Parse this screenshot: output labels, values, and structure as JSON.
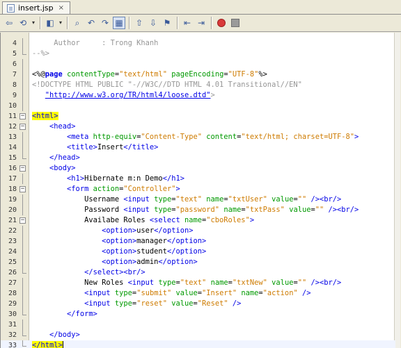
{
  "tab": {
    "label": "insert.jsp",
    "close": "×"
  },
  "toolbar": {
    "buttons": [
      {
        "name": "back-source-icon",
        "glyph": "⇦"
      },
      {
        "name": "history-icon",
        "glyph": "⟲"
      },
      {
        "name": "prev-edit-icon",
        "glyph": "◧"
      },
      {
        "name": "find-icon",
        "glyph": "⌕"
      },
      {
        "name": "find-prev-icon",
        "glyph": "↶"
      },
      {
        "name": "find-next-icon",
        "glyph": "↷"
      },
      {
        "name": "toggle-highlight-icon",
        "glyph": "▦"
      },
      {
        "name": "prev-bookmark-icon",
        "glyph": "⇧"
      },
      {
        "name": "next-bookmark-icon",
        "glyph": "⇩"
      },
      {
        "name": "toggle-bookmark-icon",
        "glyph": "⚑"
      },
      {
        "name": "shift-left-icon",
        "glyph": "⇤"
      },
      {
        "name": "shift-right-icon",
        "glyph": "⇥"
      }
    ]
  },
  "editor": {
    "lines": [
      {
        "n": "4",
        "fold": "",
        "segs": [
          {
            "c": "com",
            "t": "     Author     : Trong Khanh"
          }
        ]
      },
      {
        "n": "5",
        "fold": "end",
        "segs": [
          {
            "c": "com",
            "t": "--%>"
          }
        ]
      },
      {
        "n": "6",
        "fold": "",
        "segs": []
      },
      {
        "n": "7",
        "fold": "",
        "segs": [
          {
            "c": "dir",
            "t": "<%@"
          },
          {
            "c": "kw",
            "t": "page"
          },
          {
            "c": "txt",
            "t": " "
          },
          {
            "c": "attr",
            "t": "contentType"
          },
          {
            "c": "txt",
            "t": "="
          },
          {
            "c": "val",
            "t": "\"text/html\""
          },
          {
            "c": "txt",
            "t": " "
          },
          {
            "c": "attr",
            "t": "pageEncoding"
          },
          {
            "c": "txt",
            "t": "="
          },
          {
            "c": "val",
            "t": "\"UTF-8\""
          },
          {
            "c": "dir",
            "t": "%>"
          }
        ]
      },
      {
        "n": "8",
        "fold": "",
        "segs": [
          {
            "c": "com",
            "t": "<!DOCTYPE HTML PUBLIC \"-//W3C//DTD HTML 4.01 Transitional//EN\""
          }
        ]
      },
      {
        "n": "9",
        "fold": "",
        "segs": [
          {
            "c": "txt",
            "t": "   "
          },
          {
            "c": "link",
            "t": "\"http://www.w3.org/TR/html4/loose.dtd\""
          },
          {
            "c": "com",
            "t": ">"
          }
        ]
      },
      {
        "n": "10",
        "fold": "",
        "segs": []
      },
      {
        "n": "11",
        "fold": "open",
        "segs": [
          {
            "c": "hl",
            "t": "<html>"
          }
        ]
      },
      {
        "n": "12",
        "fold": "open",
        "segs": [
          {
            "c": "txt",
            "t": "    "
          },
          {
            "c": "tag",
            "t": "<head>"
          }
        ]
      },
      {
        "n": "13",
        "fold": "",
        "segs": [
          {
            "c": "txt",
            "t": "        "
          },
          {
            "c": "tag",
            "t": "<meta"
          },
          {
            "c": "txt",
            "t": " "
          },
          {
            "c": "attr",
            "t": "http-equiv"
          },
          {
            "c": "txt",
            "t": "="
          },
          {
            "c": "val",
            "t": "\"Content-Type\""
          },
          {
            "c": "txt",
            "t": " "
          },
          {
            "c": "attr",
            "t": "content"
          },
          {
            "c": "txt",
            "t": "="
          },
          {
            "c": "val",
            "t": "\"text/html; charset=UTF-8\""
          },
          {
            "c": "tag",
            "t": ">"
          }
        ]
      },
      {
        "n": "14",
        "fold": "",
        "segs": [
          {
            "c": "txt",
            "t": "        "
          },
          {
            "c": "tag",
            "t": "<title>"
          },
          {
            "c": "txt",
            "t": "Insert"
          },
          {
            "c": "tag",
            "t": "</title>"
          }
        ]
      },
      {
        "n": "15",
        "fold": "end",
        "segs": [
          {
            "c": "txt",
            "t": "    "
          },
          {
            "c": "tag",
            "t": "</head>"
          }
        ]
      },
      {
        "n": "16",
        "fold": "open",
        "segs": [
          {
            "c": "txt",
            "t": "    "
          },
          {
            "c": "tag",
            "t": "<body>"
          }
        ]
      },
      {
        "n": "17",
        "fold": "",
        "segs": [
          {
            "c": "txt",
            "t": "        "
          },
          {
            "c": "tag",
            "t": "<h1>"
          },
          {
            "c": "txt",
            "t": "Hibernate m:n Demo"
          },
          {
            "c": "tag",
            "t": "</h1>"
          }
        ]
      },
      {
        "n": "18",
        "fold": "open",
        "segs": [
          {
            "c": "txt",
            "t": "        "
          },
          {
            "c": "tag",
            "t": "<form"
          },
          {
            "c": "txt",
            "t": " "
          },
          {
            "c": "attr",
            "t": "action"
          },
          {
            "c": "txt",
            "t": "="
          },
          {
            "c": "val",
            "t": "\"Controller\""
          },
          {
            "c": "tag",
            "t": ">"
          }
        ]
      },
      {
        "n": "19",
        "fold": "",
        "segs": [
          {
            "c": "txt",
            "t": "            Username "
          },
          {
            "c": "tag",
            "t": "<input"
          },
          {
            "c": "txt",
            "t": " "
          },
          {
            "c": "attr",
            "t": "type"
          },
          {
            "c": "txt",
            "t": "="
          },
          {
            "c": "val",
            "t": "\"text\""
          },
          {
            "c": "txt",
            "t": " "
          },
          {
            "c": "attr",
            "t": "name"
          },
          {
            "c": "txt",
            "t": "="
          },
          {
            "c": "val",
            "t": "\"txtUser\""
          },
          {
            "c": "txt",
            "t": " "
          },
          {
            "c": "attr",
            "t": "value"
          },
          {
            "c": "txt",
            "t": "="
          },
          {
            "c": "val",
            "t": "\"\""
          },
          {
            "c": "txt",
            "t": " "
          },
          {
            "c": "tag",
            "t": "/><br/>"
          }
        ]
      },
      {
        "n": "20",
        "fold": "",
        "segs": [
          {
            "c": "txt",
            "t": "            Password "
          },
          {
            "c": "tag",
            "t": "<input"
          },
          {
            "c": "txt",
            "t": " "
          },
          {
            "c": "attr",
            "t": "type"
          },
          {
            "c": "txt",
            "t": "="
          },
          {
            "c": "val",
            "t": "\"password\""
          },
          {
            "c": "txt",
            "t": " "
          },
          {
            "c": "attr",
            "t": "name"
          },
          {
            "c": "txt",
            "t": "="
          },
          {
            "c": "val",
            "t": "\"txtPass\""
          },
          {
            "c": "txt",
            "t": " "
          },
          {
            "c": "attr",
            "t": "value"
          },
          {
            "c": "txt",
            "t": "="
          },
          {
            "c": "val",
            "t": "\"\""
          },
          {
            "c": "txt",
            "t": " "
          },
          {
            "c": "tag",
            "t": "/><br/>"
          }
        ]
      },
      {
        "n": "21",
        "fold": "open",
        "segs": [
          {
            "c": "txt",
            "t": "            Availabe Roles "
          },
          {
            "c": "tag",
            "t": "<select"
          },
          {
            "c": "txt",
            "t": " "
          },
          {
            "c": "attr",
            "t": "name"
          },
          {
            "c": "txt",
            "t": "="
          },
          {
            "c": "val",
            "t": "\"cboRoles\""
          },
          {
            "c": "tag",
            "t": ">"
          }
        ]
      },
      {
        "n": "22",
        "fold": "",
        "segs": [
          {
            "c": "txt",
            "t": "                "
          },
          {
            "c": "tag",
            "t": "<option>"
          },
          {
            "c": "txt",
            "t": "user"
          },
          {
            "c": "tag",
            "t": "</option>"
          }
        ]
      },
      {
        "n": "23",
        "fold": "",
        "segs": [
          {
            "c": "txt",
            "t": "                "
          },
          {
            "c": "tag",
            "t": "<option>"
          },
          {
            "c": "txt",
            "t": "manager"
          },
          {
            "c": "tag",
            "t": "</option>"
          }
        ]
      },
      {
        "n": "24",
        "fold": "",
        "segs": [
          {
            "c": "txt",
            "t": "                "
          },
          {
            "c": "tag",
            "t": "<option>"
          },
          {
            "c": "txt",
            "t": "student"
          },
          {
            "c": "tag",
            "t": "</option>"
          }
        ]
      },
      {
        "n": "25",
        "fold": "",
        "segs": [
          {
            "c": "txt",
            "t": "                "
          },
          {
            "c": "tag",
            "t": "<option>"
          },
          {
            "c": "txt",
            "t": "admin"
          },
          {
            "c": "tag",
            "t": "</option>"
          }
        ]
      },
      {
        "n": "26",
        "fold": "end",
        "segs": [
          {
            "c": "txt",
            "t": "            "
          },
          {
            "c": "tag",
            "t": "</select><br/>"
          }
        ]
      },
      {
        "n": "27",
        "fold": "",
        "segs": [
          {
            "c": "txt",
            "t": "            New Roles "
          },
          {
            "c": "tag",
            "t": "<input"
          },
          {
            "c": "txt",
            "t": " "
          },
          {
            "c": "attr",
            "t": "type"
          },
          {
            "c": "txt",
            "t": "="
          },
          {
            "c": "val",
            "t": "\"text\""
          },
          {
            "c": "txt",
            "t": " "
          },
          {
            "c": "attr",
            "t": "name"
          },
          {
            "c": "txt",
            "t": "="
          },
          {
            "c": "val",
            "t": "\"txtNew\""
          },
          {
            "c": "txt",
            "t": " "
          },
          {
            "c": "attr",
            "t": "value"
          },
          {
            "c": "txt",
            "t": "="
          },
          {
            "c": "val",
            "t": "\"\""
          },
          {
            "c": "txt",
            "t": " "
          },
          {
            "c": "tag",
            "t": "/><br/>"
          }
        ]
      },
      {
        "n": "28",
        "fold": "",
        "segs": [
          {
            "c": "txt",
            "t": "            "
          },
          {
            "c": "tag",
            "t": "<input"
          },
          {
            "c": "txt",
            "t": " "
          },
          {
            "c": "attr",
            "t": "type"
          },
          {
            "c": "txt",
            "t": "="
          },
          {
            "c": "val",
            "t": "\"submit\""
          },
          {
            "c": "txt",
            "t": " "
          },
          {
            "c": "attr",
            "t": "value"
          },
          {
            "c": "txt",
            "t": "="
          },
          {
            "c": "val",
            "t": "\"Insert\""
          },
          {
            "c": "txt",
            "t": " "
          },
          {
            "c": "attr",
            "t": "name"
          },
          {
            "c": "txt",
            "t": "="
          },
          {
            "c": "val",
            "t": "\"action\""
          },
          {
            "c": "txt",
            "t": " "
          },
          {
            "c": "tag",
            "t": "/>"
          }
        ]
      },
      {
        "n": "29",
        "fold": "",
        "segs": [
          {
            "c": "txt",
            "t": "            "
          },
          {
            "c": "tag",
            "t": "<input"
          },
          {
            "c": "txt",
            "t": " "
          },
          {
            "c": "attr",
            "t": "type"
          },
          {
            "c": "txt",
            "t": "="
          },
          {
            "c": "val",
            "t": "\"reset\""
          },
          {
            "c": "txt",
            "t": " "
          },
          {
            "c": "attr",
            "t": "value"
          },
          {
            "c": "txt",
            "t": "="
          },
          {
            "c": "val",
            "t": "\"Reset\""
          },
          {
            "c": "txt",
            "t": " "
          },
          {
            "c": "tag",
            "t": "/>"
          }
        ]
      },
      {
        "n": "30",
        "fold": "end",
        "segs": [
          {
            "c": "txt",
            "t": "        "
          },
          {
            "c": "tag",
            "t": "</form>"
          }
        ]
      },
      {
        "n": "31",
        "fold": "",
        "segs": []
      },
      {
        "n": "32",
        "fold": "end",
        "segs": [
          {
            "c": "txt",
            "t": "    "
          },
          {
            "c": "tag",
            "t": "</body>"
          }
        ]
      },
      {
        "n": "33",
        "fold": "end",
        "segs": [
          {
            "c": "hl",
            "t": "</html>"
          }
        ]
      }
    ]
  }
}
